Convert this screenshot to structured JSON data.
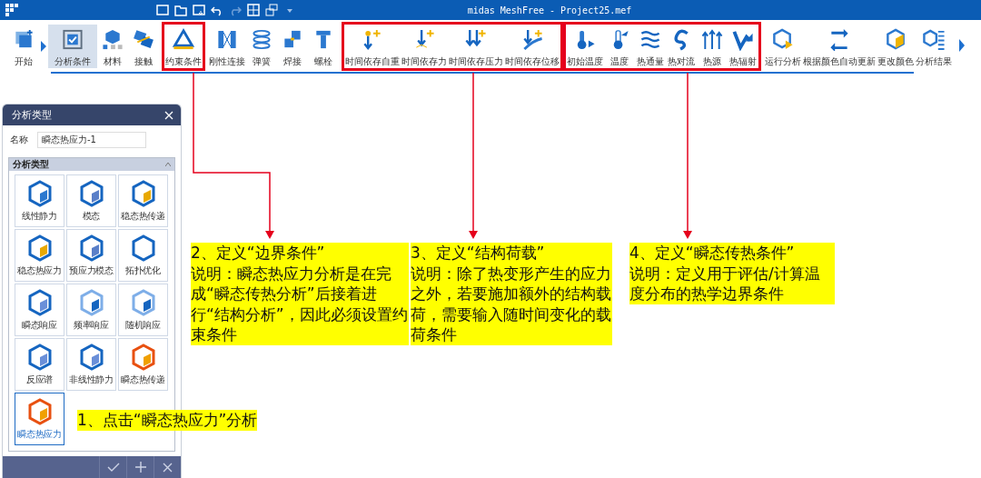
{
  "window": {
    "title": "midas MeshFree - Project25.mef"
  },
  "ribbon": {
    "segments": [
      {
        "highlighted": false,
        "items": [
          {
            "label": "开始",
            "selected": false
          },
          {
            "label": "分析条件",
            "selected": true
          },
          {
            "label": "材料",
            "selected": false
          },
          {
            "label": "接触",
            "selected": false
          }
        ]
      },
      {
        "highlighted": true,
        "items": [
          {
            "label": "约束条件",
            "selected": false
          }
        ]
      },
      {
        "highlighted": false,
        "items": [
          {
            "label": "刚性连接",
            "selected": false
          },
          {
            "label": "弹簧",
            "selected": false
          },
          {
            "label": "焊接",
            "selected": false
          },
          {
            "label": "螺栓",
            "selected": false
          }
        ]
      },
      {
        "highlighted": true,
        "items": [
          {
            "label": "时间依存自重",
            "selected": false
          },
          {
            "label": "时间依存力",
            "selected": false
          },
          {
            "label": "时间依存压力",
            "selected": false
          },
          {
            "label": "时间依存位移",
            "selected": false
          }
        ]
      },
      {
        "highlighted": true,
        "items": [
          {
            "label": "初始温度",
            "selected": false
          },
          {
            "label": "温度",
            "selected": false
          },
          {
            "label": "热通量",
            "selected": false
          },
          {
            "label": "热对流",
            "selected": false
          },
          {
            "label": "热源",
            "selected": false
          },
          {
            "label": "热辐射",
            "selected": false
          }
        ]
      },
      {
        "highlighted": false,
        "items": [
          {
            "label": "运行分析",
            "selected": false
          },
          {
            "label": "根据颜色自动更新",
            "selected": false
          },
          {
            "label": "更改颜色",
            "selected": false
          },
          {
            "label": "分析结果",
            "selected": false
          }
        ]
      }
    ]
  },
  "panel": {
    "title": "分析类型",
    "name_label": "名称",
    "name_value": "瞬态热应力-1",
    "group_title": "分析类型",
    "types": [
      {
        "label": "线性静力",
        "selected": false
      },
      {
        "label": "模态",
        "selected": false
      },
      {
        "label": "稳态热传递",
        "selected": false
      },
      {
        "label": "稳态热应力",
        "selected": false
      },
      {
        "label": "预应力模态",
        "selected": false
      },
      {
        "label": "拓扑优化",
        "selected": false
      },
      {
        "label": "瞬态响应",
        "selected": false
      },
      {
        "label": "频率响应",
        "selected": false
      },
      {
        "label": "随机响应",
        "selected": false
      },
      {
        "label": "反应谱",
        "selected": false
      },
      {
        "label": "非线性静力",
        "selected": false
      },
      {
        "label": "瞬态热传递",
        "selected": false
      },
      {
        "label": "瞬态热应力",
        "selected": true
      }
    ]
  },
  "annotations": [
    {
      "heading": "1、点击“瞬态热应力”分析"
    },
    {
      "heading": "2、定义“边界条件”",
      "body": "说明：瞬态热应力分析是在完成“瞬态传热分析”后接着进行“结构分析”，因此必须设置约束条件"
    },
    {
      "heading": "3、定义“结构荷载”",
      "body": "说明：除了热变形产生的应力之外，若要施加额外的结构载荷，需要输入随时间变化的载荷条件"
    },
    {
      "heading": "4、定义“瞬态传热条件”",
      "body": "说明：定义用于评估/计算温度分布的热学边界条件"
    }
  ]
}
